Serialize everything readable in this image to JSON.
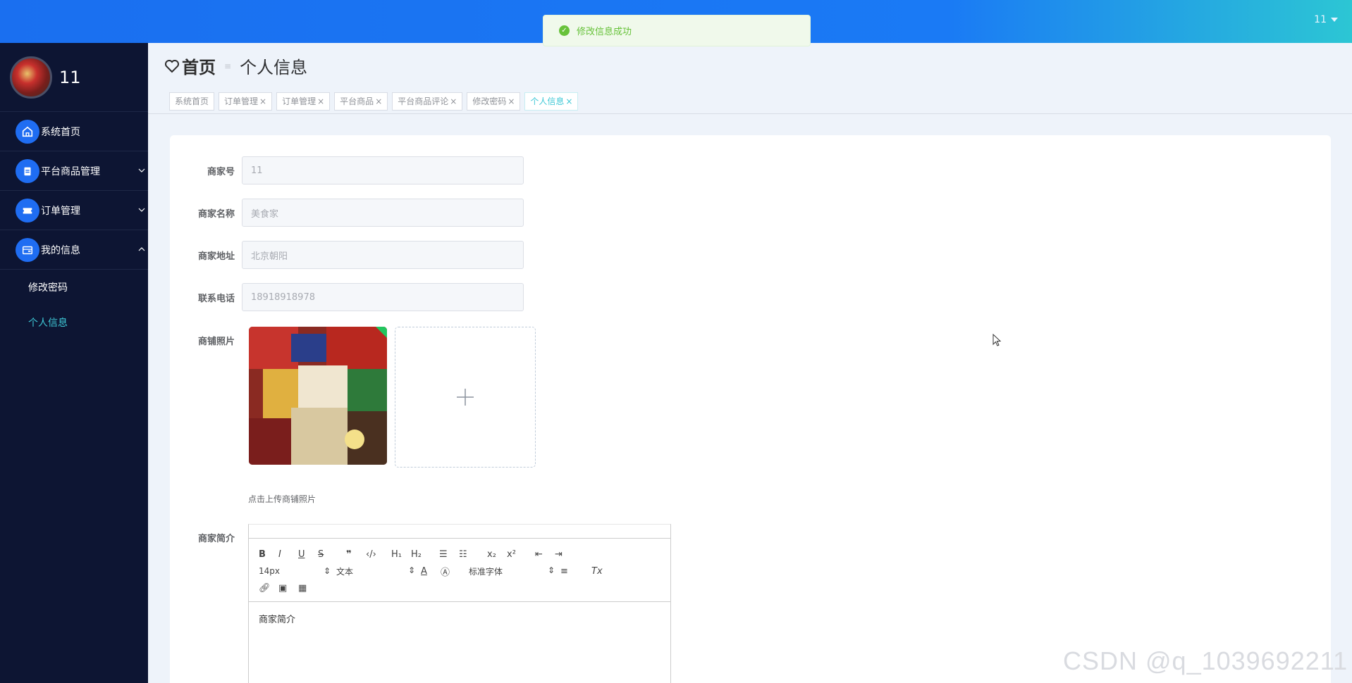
{
  "header": {
    "user": "11"
  },
  "toast": {
    "message": "修改信息成功"
  },
  "sidebar": {
    "profile_name": "11",
    "items": [
      {
        "label": "系统首页"
      },
      {
        "label": "平台商品管理"
      },
      {
        "label": "订单管理"
      },
      {
        "label": "我的信息"
      }
    ],
    "sub_items": [
      {
        "label": "修改密码"
      },
      {
        "label": "个人信息"
      }
    ]
  },
  "breadcrumb": {
    "home": "首页",
    "sep": "≡",
    "current": "个人信息"
  },
  "tabs": [
    {
      "label": "系统首页",
      "closable": false
    },
    {
      "label": "订单管理",
      "closable": true
    },
    {
      "label": "订单管理",
      "closable": true
    },
    {
      "label": "平台商品",
      "closable": true
    },
    {
      "label": "平台商品评论",
      "closable": true
    },
    {
      "label": "修改密码",
      "closable": true
    },
    {
      "label": "个人信息",
      "closable": true
    }
  ],
  "tab_close": "×",
  "form": {
    "merchant_no": {
      "label": "商家号",
      "value": "11"
    },
    "merchant_name": {
      "label": "商家名称",
      "value": "美食家"
    },
    "merchant_address": {
      "label": "商家地址",
      "value": "北京朝阳"
    },
    "phone": {
      "label": "联系电话",
      "value": "18918918978"
    },
    "photo": {
      "label": "商铺照片",
      "hint": "点击上传商铺照片"
    },
    "intro": {
      "label": "商家简介",
      "content": "商家简介"
    }
  },
  "editor": {
    "font_size": "14px",
    "paragraph": "文本",
    "font_family": "标准字体"
  },
  "watermark": "CSDN @q_1039692211"
}
